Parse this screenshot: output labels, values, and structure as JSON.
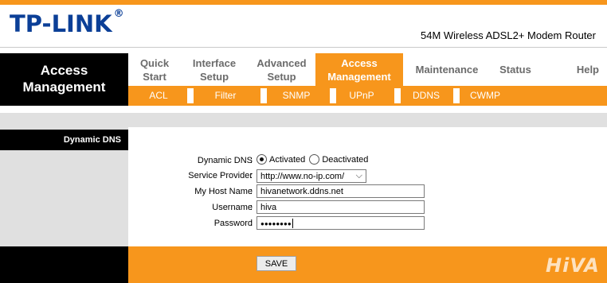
{
  "brand": {
    "logo_text": "TP-LINK",
    "logo_mark": "®",
    "model": "54M Wireless ADSL2+ Modem Router"
  },
  "section_title": {
    "line1": "Access",
    "line2": "Management"
  },
  "menu": [
    {
      "line1": "Quick",
      "line2": "Start"
    },
    {
      "line1": "Interface",
      "line2": "Setup"
    },
    {
      "line1": "Advanced",
      "line2": "Setup"
    },
    {
      "line1": "Access",
      "line2": "Management"
    },
    {
      "line1": "Maintenance",
      "line2": ""
    },
    {
      "line1": "Status",
      "line2": ""
    },
    {
      "line1": "Help",
      "line2": ""
    }
  ],
  "submenu": [
    "ACL",
    "Filter",
    "SNMP",
    "UPnP",
    "DDNS",
    "CWMP"
  ],
  "sidebar": {
    "title": "Dynamic DNS"
  },
  "form": {
    "dynamic_dns": {
      "label": "Dynamic DNS",
      "options": [
        "Activated",
        "Deactivated"
      ],
      "selected": "Activated"
    },
    "service_provider": {
      "label": "Service Provider",
      "value": "http://www.no-ip.com/"
    },
    "host_name": {
      "label": "My Host Name",
      "value": "hivanetwork.ddns.net"
    },
    "username": {
      "label": "Username",
      "value": "hiva"
    },
    "password": {
      "label": "Password",
      "value": "●●●●●●●●"
    }
  },
  "save_label": "SAVE",
  "watermark": "HiVA",
  "colors": {
    "accent": "#f7961c",
    "brand_blue": "#0b3f97",
    "panel_gray": "#e0e0e0",
    "black": "#000000"
  }
}
